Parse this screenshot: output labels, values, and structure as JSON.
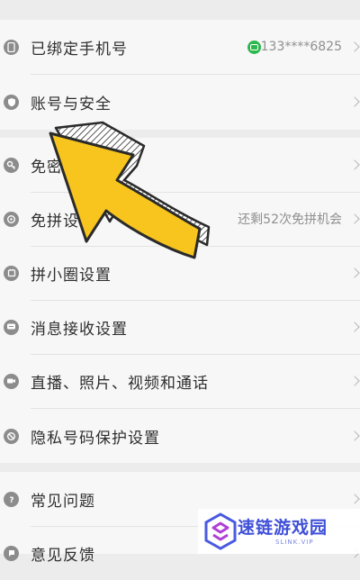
{
  "settings": {
    "items": [
      {
        "label": "已绑定手机号",
        "value": "133****6825",
        "icon": "phone-icon"
      },
      {
        "label": "账号与安全",
        "value": "",
        "icon": "shield-icon"
      },
      {
        "label": "免密支付",
        "value": "",
        "icon": "key-icon"
      },
      {
        "label": "免拼设置",
        "value": "还剩52次免拼机会",
        "icon": "target-icon"
      },
      {
        "label": "拼小圈设置",
        "value": "",
        "icon": "circle-icon"
      },
      {
        "label": "消息接收设置",
        "value": "",
        "icon": "message-icon"
      },
      {
        "label": "直播、照片、视频和通话",
        "value": "",
        "icon": "camera-icon"
      },
      {
        "label": "隐私号码保护设置",
        "value": "",
        "icon": "privacy-icon"
      },
      {
        "label": "常见问题",
        "value": "",
        "icon": "question-icon"
      },
      {
        "label": "意见反馈",
        "value": "",
        "icon": "feedback-icon"
      }
    ]
  },
  "watermark": {
    "title": "速链游戏园",
    "subtitle": "SLINK.VIP"
  },
  "colors": {
    "arrow": "#f7c51e",
    "badge": "#2db84d",
    "brand": "#3f4fd8"
  }
}
